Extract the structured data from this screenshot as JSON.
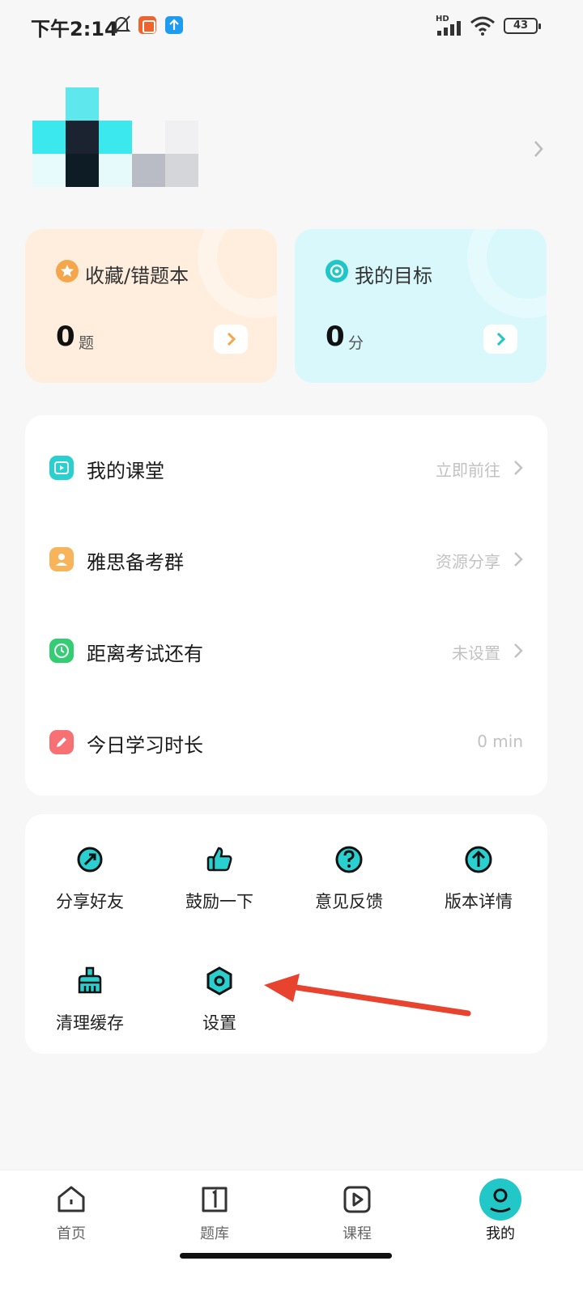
{
  "status_bar": {
    "time": "下午2:14",
    "battery": "43",
    "network": "HD"
  },
  "cards": {
    "favorites": {
      "title": "收藏/错题本",
      "value": "0",
      "unit": "题",
      "icon": "star-icon",
      "color": "#f5a64a"
    },
    "goal": {
      "title": "我的目标",
      "value": "0",
      "unit": "分",
      "icon": "target-icon",
      "color": "#1ec7c7"
    }
  },
  "list": [
    {
      "label": "我的课堂",
      "value": "立即前往",
      "icon": "play-icon",
      "color": "#2ad0cf",
      "arrow": true
    },
    {
      "label": "雅思备考群",
      "value": "资源分享",
      "icon": "person-icon",
      "color": "#f7b45a",
      "arrow": true
    },
    {
      "label": "距离考试还有",
      "value": "未设置",
      "icon": "clock-icon",
      "color": "#34cd73",
      "arrow": true
    },
    {
      "label": "今日学习时长",
      "value": "0 min",
      "icon": "pencil-icon",
      "color": "#f77074",
      "arrow": false
    }
  ],
  "grid": [
    {
      "label": "分享好友",
      "icon": "share-icon"
    },
    {
      "label": "鼓励一下",
      "icon": "thumbs-up-icon"
    },
    {
      "label": "意见反馈",
      "icon": "question-icon"
    },
    {
      "label": "版本详情",
      "icon": "upgrade-icon"
    },
    {
      "label": "清理缓存",
      "icon": "broom-icon"
    },
    {
      "label": "设置",
      "icon": "settings-hex-icon"
    }
  ],
  "bottom_nav": [
    {
      "label": "首页",
      "icon": "home-icon",
      "active": false
    },
    {
      "label": "题库",
      "icon": "book-icon",
      "active": false
    },
    {
      "label": "课程",
      "icon": "video-icon",
      "active": false
    },
    {
      "label": "我的",
      "icon": "profile-icon",
      "active": true
    }
  ],
  "colors": {
    "accent": "#22c8c8",
    "annotation_arrow": "#e8432e"
  }
}
